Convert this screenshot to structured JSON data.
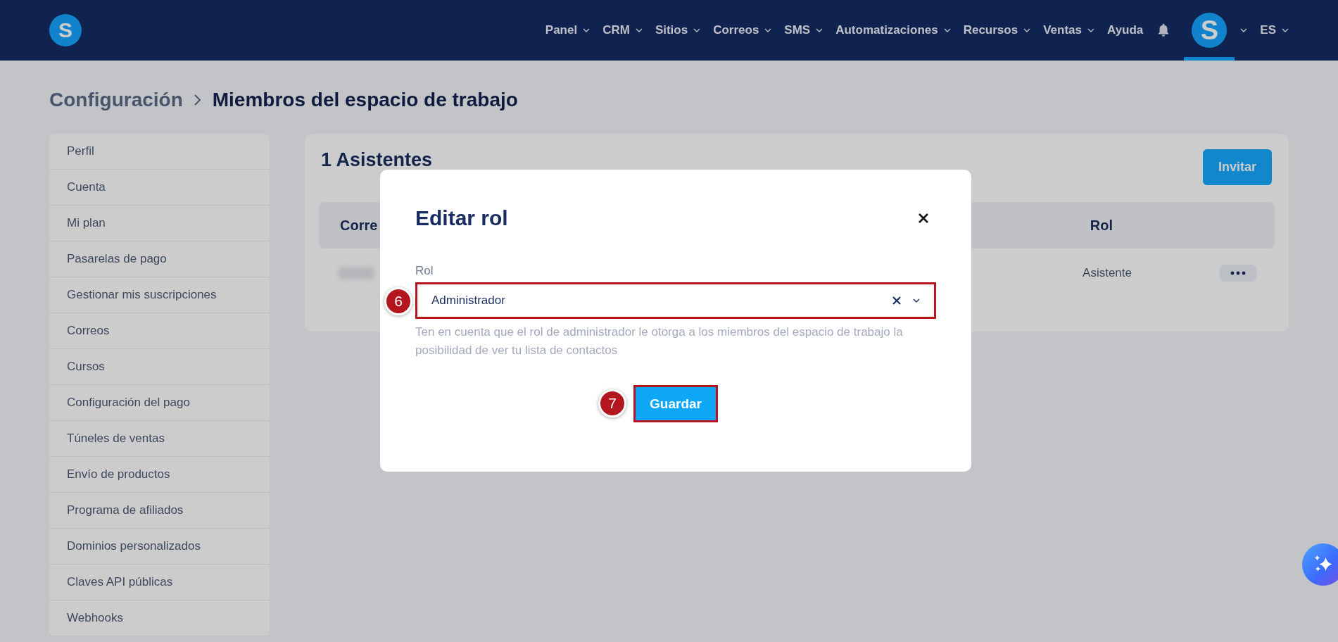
{
  "nav": {
    "logo": "S",
    "items": [
      {
        "label": "Panel",
        "has_menu": true
      },
      {
        "label": "CRM",
        "has_menu": true
      },
      {
        "label": "Sitios",
        "has_menu": true
      },
      {
        "label": "Correos",
        "has_menu": true
      },
      {
        "label": "SMS",
        "has_menu": true
      },
      {
        "label": "Automatizaciones",
        "has_menu": true
      },
      {
        "label": "Recursos",
        "has_menu": true
      },
      {
        "label": "Ventas",
        "has_menu": true
      },
      {
        "label": "Ayuda",
        "has_menu": false
      }
    ],
    "avatar": {
      "initial": "S",
      "selected": true
    },
    "language": "ES"
  },
  "breadcrumb": [
    "Configuración",
    "Miembros del espacio de trabajo"
  ],
  "sidebar": {
    "items": [
      "Perfil",
      "Cuenta",
      "Mi plan",
      "Pasarelas de pago",
      "Gestionar mis suscripciones",
      "Correos",
      "Cursos",
      "Configuración del pago",
      "Túneles de ventas",
      "Envío de productos",
      "Programa de afiliados",
      "Dominios personalizados",
      "Claves API públicas",
      "Webhooks"
    ]
  },
  "members": {
    "title": "1 Asistentes",
    "invite_button": "Invitar",
    "columns": [
      "Corre",
      "Rol"
    ],
    "rows": [
      {
        "role": "Asistente"
      }
    ]
  },
  "dialog": {
    "title": "Editar rol",
    "field": {
      "label": "Rol",
      "value": "Administrador",
      "help": "Ten en cuenta que el rol de administrador le otorga a los miembros del espacio de trabajo la posibilidad de ver tu lista de contactos"
    },
    "save_button": "Guardar"
  },
  "annotations": [
    {
      "label": "6"
    },
    {
      "label": "7"
    }
  ]
}
